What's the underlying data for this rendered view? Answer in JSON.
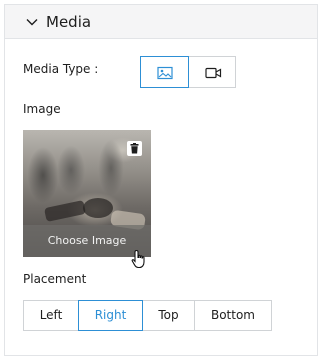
{
  "panel": {
    "title": "Media",
    "toggle_icon": "chevron-down-icon"
  },
  "media_type": {
    "label": "Media Type :",
    "options": [
      {
        "icon": "image-icon",
        "selected": true
      },
      {
        "icon": "video-camera-icon",
        "selected": false
      }
    ]
  },
  "image": {
    "label": "Image",
    "choose_label": "Choose Image",
    "delete_icon": "trash-icon"
  },
  "placement": {
    "label": "Placement",
    "options": [
      "Left",
      "Right",
      "Top",
      "Bottom"
    ],
    "selected": "Right"
  },
  "colors": {
    "accent": "#2d8fd5",
    "border": "#d0d3d6",
    "header_bg": "#f5f5f6"
  }
}
